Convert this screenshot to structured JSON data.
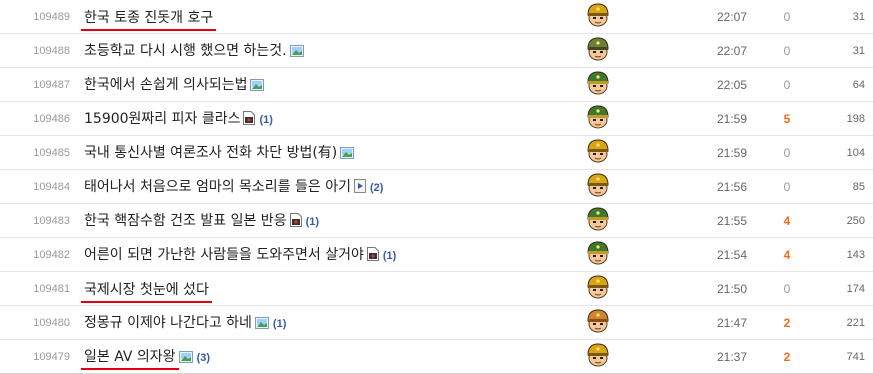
{
  "posts": [
    {
      "no": "109489",
      "title": "한국 토종 진돗개 호구",
      "attach": "",
      "comments": "",
      "avatar": "yellow-helmet",
      "time": "22:07",
      "votes": "0",
      "hits": "31",
      "highlight": true
    },
    {
      "no": "109488",
      "title": "초등학교 다시 시행 했으면 하는것.",
      "attach": "image",
      "comments": "",
      "avatar": "green-helmet",
      "time": "22:07",
      "votes": "0",
      "hits": "31",
      "highlight": false
    },
    {
      "no": "109487",
      "title": "한국에서 손쉽게 의사되는법",
      "attach": "image",
      "comments": "",
      "avatar": "green-officer",
      "time": "22:05",
      "votes": "0",
      "hits": "64",
      "highlight": false
    },
    {
      "no": "109486",
      "title": "15900원짜리 피자 클라스",
      "attach": "photo",
      "comments": "(1)",
      "avatar": "green-officer",
      "time": "21:59",
      "votes": "5",
      "hits": "198",
      "highlight": false
    },
    {
      "no": "109485",
      "title": "국내 통신사별 여론조사 전화 차단 방법(有)",
      "attach": "image",
      "comments": "",
      "avatar": "yellow-helmet",
      "time": "21:59",
      "votes": "0",
      "hits": "104",
      "highlight": false
    },
    {
      "no": "109484",
      "title": "태어나서 처음으로 엄마의 목소리를 들은 아기",
      "attach": "video",
      "comments": "(2)",
      "avatar": "yellow-helmet",
      "time": "21:56",
      "votes": "0",
      "hits": "85",
      "highlight": false
    },
    {
      "no": "109483",
      "title": "한국 핵잠수함 건조 발표 일본 반응",
      "attach": "photo",
      "comments": "(1)",
      "avatar": "green-officer",
      "time": "21:55",
      "votes": "4",
      "hits": "250",
      "highlight": false
    },
    {
      "no": "109482",
      "title": "어른이 되면 가난한 사람들을 도와주면서 살거야",
      "attach": "photo",
      "comments": "(1)",
      "avatar": "green-officer",
      "time": "21:54",
      "votes": "4",
      "hits": "143",
      "highlight": false
    },
    {
      "no": "109481",
      "title": "국제시장 첫눈에 섰다",
      "attach": "",
      "comments": "",
      "avatar": "yellow-helmet",
      "time": "21:50",
      "votes": "0",
      "hits": "174",
      "highlight": true
    },
    {
      "no": "109480",
      "title": "정몽규 이제야 나간다고 하네",
      "attach": "image",
      "comments": "(1)",
      "avatar": "orange-cap",
      "time": "21:47",
      "votes": "2",
      "hits": "221",
      "highlight": false
    },
    {
      "no": "109479",
      "title": "일본 AV 의자왕",
      "attach": "image",
      "comments": "(3)",
      "avatar": "yellow-helmet",
      "time": "21:37",
      "votes": "2",
      "hits": "741",
      "highlight": true
    }
  ],
  "colors": {
    "highlight_underline": "#e0000f",
    "vote_hot": "#f26a1b",
    "comment_count": "#3a59a8"
  }
}
